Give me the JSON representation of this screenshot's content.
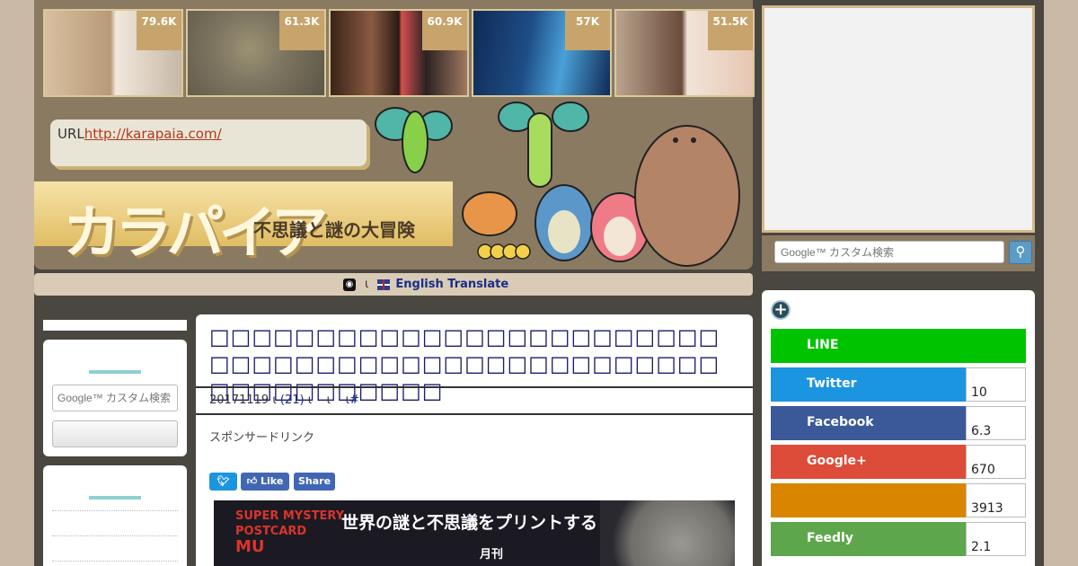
{
  "thumbnails": [
    {
      "count": "79.6K",
      "colors": [
        "#d8c0a0",
        "#8a6a48",
        "#f2e8dc"
      ]
    },
    {
      "count": "61.3K",
      "colors": [
        "#7d7560",
        "#5c5646",
        "#9b9274"
      ]
    },
    {
      "count": "60.9K",
      "colors": [
        "#3b2318",
        "#8a5a42",
        "#2a1b14"
      ]
    },
    {
      "count": "57K",
      "colors": [
        "#1e4d86",
        "#4aa0d8",
        "#0f2a55"
      ]
    },
    {
      "count": "51.5K",
      "colors": [
        "#b8a48e",
        "#6a4b3a",
        "#e8c6b2"
      ]
    }
  ],
  "header": {
    "url_label": "URL",
    "url_link": "http://karapaia.com/",
    "logo_text": "カラパイア",
    "logo_subtitle": "不思議と謎の大冒険"
  },
  "translate": {
    "globe_icon": "globe-icon",
    "separator": "ι",
    "link_text": "English Translate"
  },
  "right_sidebar": {
    "search_placeholder": "Google™ カスタム検索",
    "search_button_icon": "magnifier-icon",
    "plus_icon": "plus-icon",
    "share_buttons": [
      {
        "label": "LINE",
        "count": "",
        "color": "#00c300"
      },
      {
        "label": "Twitter",
        "count": "10",
        "color": "#1b95e0"
      },
      {
        "label": "Facebook",
        "count": "6.3",
        "color": "#3b5998"
      },
      {
        "label": "Google+",
        "count": "670",
        "color": "#dd4b39"
      },
      {
        "label": "",
        "count": "3913",
        "color": "#d98500"
      },
      {
        "label": "Feedly",
        "count": "2.1",
        "color": "#5ea64c"
      }
    ]
  },
  "left_sidebar": {
    "search_placeholder": "Google™ カスタム検索",
    "search_button_label": ""
  },
  "article": {
    "title": "□□□□□□□□□□□□□□□□□□□□□□□□□□□□□□□□□□□□□□□□□□□□□□□□□□□□□□□□□□□",
    "date": "20171119",
    "sep1": "ι",
    "comments": "(21)",
    "sep2": "ι",
    "sep3": "ι",
    "sep4": "ι",
    "hash": "#",
    "sponsor": "スポンサードリンク",
    "share": {
      "twitter_icon": "twitter-bird-icon",
      "like_label": "Like",
      "share_label": "Share"
    }
  },
  "banner": {
    "left_text": [
      "SUPER MYSTERY",
      "POSTCARD",
      "MU"
    ],
    "title": "世界の謎と不思議をプリントする",
    "sub": "月刊"
  }
}
